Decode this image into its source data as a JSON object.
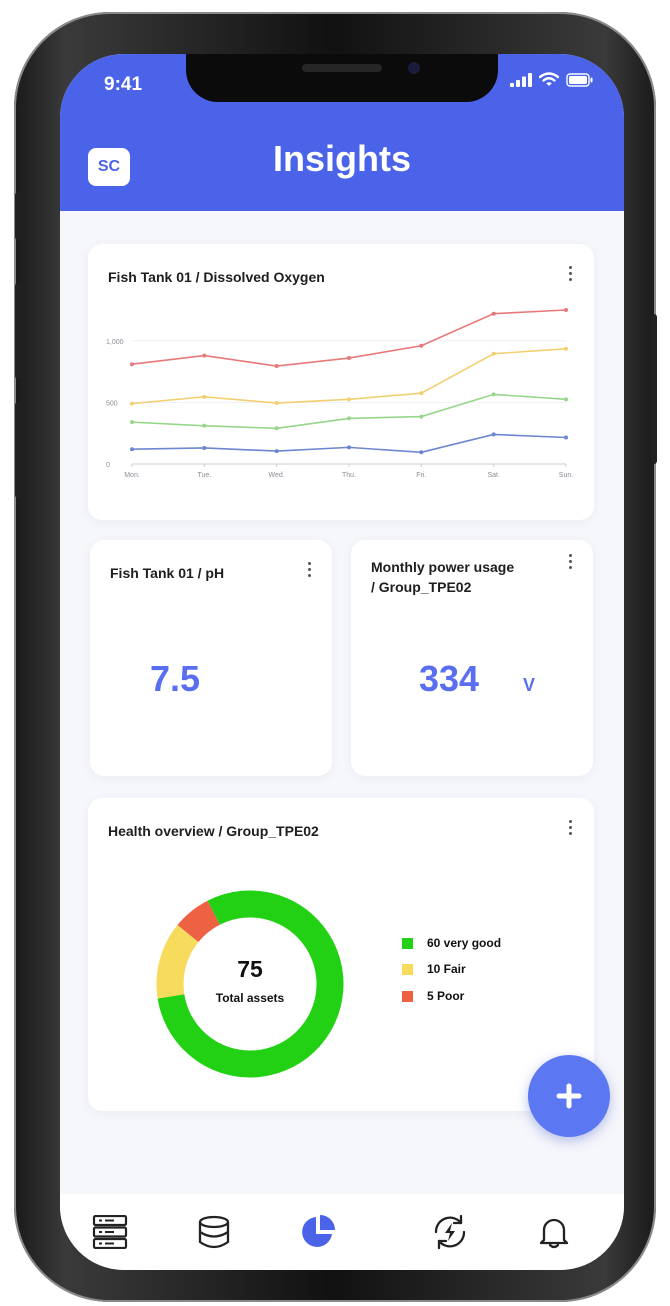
{
  "status_bar": {
    "time": "9:41"
  },
  "header": {
    "logo_text": "SC",
    "title": "Insights"
  },
  "cards": {
    "oxygen": {
      "title": "Fish Tank 01 / Dissolved Oxygen"
    },
    "ph": {
      "title": "Fish Tank 01 / pH",
      "value": "7.5"
    },
    "power": {
      "title_line1": "Monthly power usage",
      "title_line2": "/ Group_TPE02",
      "value": "334",
      "unit": "V"
    },
    "health": {
      "title": "Health overview / Group_TPE02",
      "center_value": "75",
      "center_label": "Total assets"
    }
  },
  "chart_data": [
    {
      "type": "line",
      "title": "Fish Tank 01 / Dissolved Oxygen",
      "categories": [
        "Mon.",
        "Tue.",
        "Wed.",
        "Thu.",
        "Fri.",
        "Sat.",
        "Sun."
      ],
      "ylim": [
        0,
        1250
      ],
      "yticks": [
        0,
        500,
        1000
      ],
      "ytick_labels": [
        "0",
        "500",
        "1,000"
      ],
      "grid": true,
      "series": [
        {
          "color": "#e8787a",
          "values": [
            810,
            880,
            795,
            860,
            960,
            1220,
            1250
          ]
        },
        {
          "color": "#f2cf70",
          "values": [
            490,
            545,
            495,
            525,
            575,
            895,
            935
          ]
        },
        {
          "color": "#96d68a",
          "values": [
            340,
            310,
            290,
            370,
            385,
            565,
            525
          ]
        },
        {
          "color": "#6d86cf",
          "values": [
            120,
            130,
            105,
            135,
            95,
            240,
            215
          ]
        }
      ]
    },
    {
      "type": "pie",
      "title": "Health overview / Group_TPE02",
      "series": [
        {
          "name": "60 very good",
          "value": 60,
          "color": "#22d114"
        },
        {
          "name": "10 Fair",
          "value": 10,
          "color": "#f6db5c"
        },
        {
          "name": "5 Poor",
          "value": 5,
          "color": "#ee6244"
        }
      ]
    }
  ],
  "colors": {
    "header": "#4a63e8",
    "accent": "#5a6ff0",
    "fab": "#5b77f2"
  },
  "tabbar": {
    "items": [
      "server-icon",
      "database-icon",
      "pie-chart-icon",
      "energy-cycle-icon",
      "bell-icon"
    ],
    "active_index": 2
  }
}
